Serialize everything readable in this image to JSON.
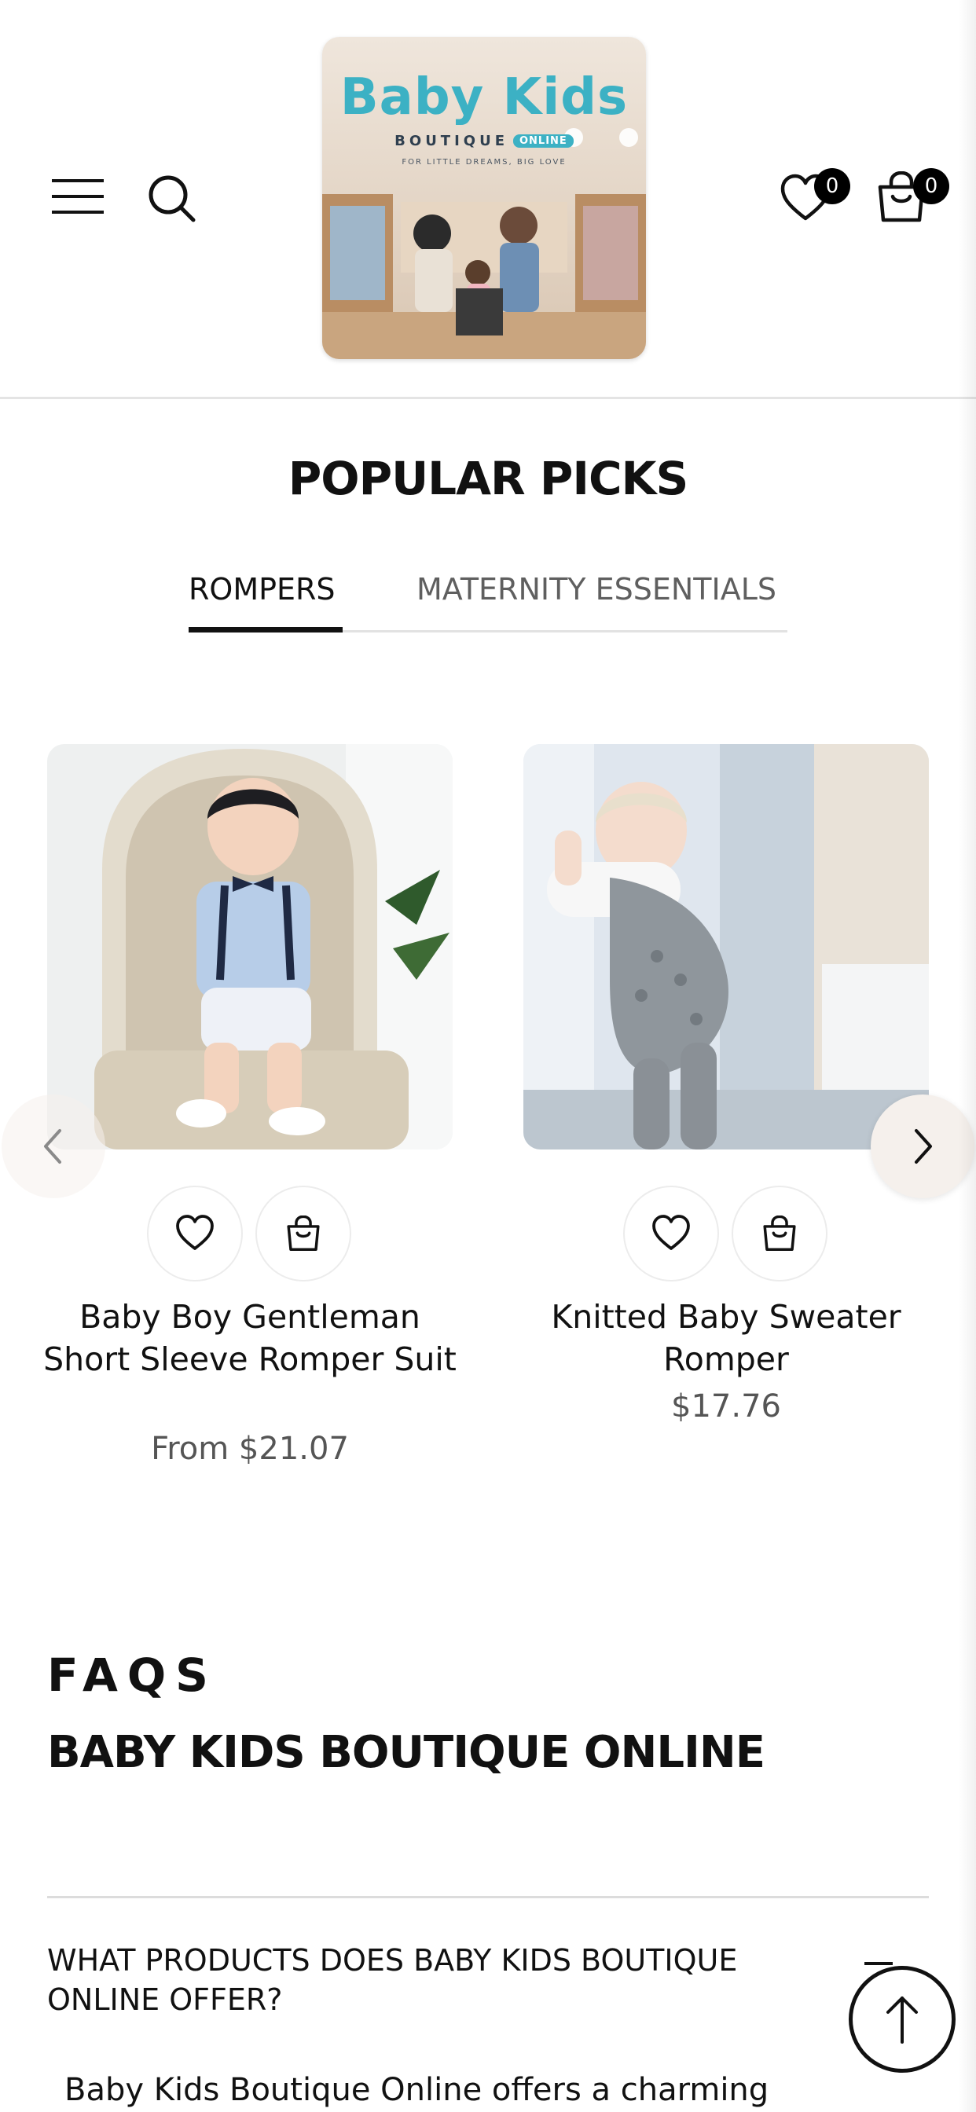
{
  "header": {
    "wishlist_count": "0",
    "cart_count": "0",
    "logo": {
      "wordmark": "Baby Kids",
      "subtitle": "BOUTIQUE",
      "pill": "ONLINE",
      "tagline": "FOR LITTLE DREAMS, BIG LOVE"
    },
    "icons": [
      "menu-icon",
      "search-icon",
      "heart-icon",
      "shopping-bag-icon"
    ]
  },
  "popular": {
    "title": "POPULAR PICKS",
    "tabs": [
      {
        "label": "ROMPERS",
        "active": true
      },
      {
        "label": "MATERNITY ESSENTIALS",
        "active": false
      }
    ],
    "products": [
      {
        "name": "Baby Boy Gentleman Short Sleeve Romper Suit",
        "price": "From $21.07"
      },
      {
        "name": "Knitted Baby Sweater Romper",
        "price": "$17.76"
      }
    ]
  },
  "faq": {
    "eyebrow": "FAQS",
    "heading": "BABY KIDS BOUTIQUE ONLINE",
    "question": "WHAT PRODUCTS DOES BABY KIDS BOUTIQUE ONLINE OFFER?",
    "answer": "Baby Kids Boutique Online offers a charming"
  },
  "colors": {
    "accent": "#111111",
    "muted_text": "#555555",
    "arrow_bg": "#f5f0ec",
    "logo_teal": "#3cb1c4"
  }
}
